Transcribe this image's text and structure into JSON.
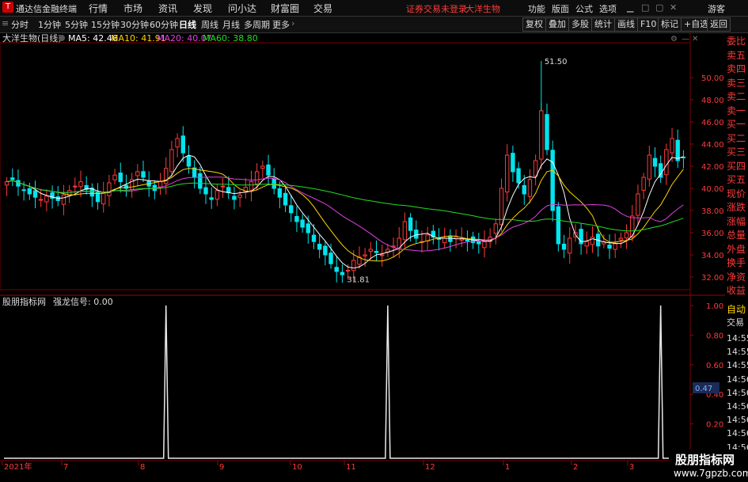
{
  "titlebar": {
    "app_name": "通达信金融终端",
    "menus": [
      "行情",
      "市场",
      "资讯",
      "发现",
      "问小达",
      "财富圈",
      "交易"
    ],
    "login_status": "证券交易未登录",
    "stock_name": "大洋生物",
    "right_menus": [
      "功能",
      "版面",
      "公式",
      "选项"
    ],
    "guest": "游客"
  },
  "toolbar": {
    "periods": [
      "分时",
      "1分钟",
      "5分钟",
      "15分钟",
      "30分钟",
      "60分钟",
      "日线",
      "周线",
      "月线",
      "多周期",
      "更多"
    ],
    "active_period": "日线",
    "right_buttons": [
      "复权",
      "叠加",
      "多股",
      "统计",
      "画线",
      "F10",
      "标记",
      "+自选",
      "返回"
    ]
  },
  "main_chart": {
    "title": "大洋生物(日线)",
    "ma": [
      {
        "label": "MA5: 42.46",
        "color": "#ffffff"
      },
      {
        "label": "MA10: 41.91",
        "color": "#ffd400"
      },
      {
        "label": "MA20: 40.07",
        "color": "#e040e0"
      },
      {
        "label": "MA60: 38.80",
        "color": "#22dd22"
      }
    ],
    "y_ticks": [
      "50.00",
      "48.00",
      "46.00",
      "44.00",
      "42.00",
      "40.00",
      "38.00",
      "36.00",
      "34.00",
      "32.00"
    ],
    "high_label": "51.50",
    "low_label": "31.81"
  },
  "indicator": {
    "title": "股朋指标网",
    "signal_label": "强龙信号: 0.00",
    "y_ticks": [
      "1.00",
      "0.80",
      "0.60",
      "0.40",
      "0.20"
    ],
    "cursor_value": "0.47"
  },
  "x_axis": {
    "labels": [
      "2021年",
      "7",
      "8",
      "9",
      "10",
      "11",
      "12",
      "1",
      "2",
      "3"
    ]
  },
  "sidebar": {
    "items": [
      "委比",
      "卖五",
      "卖四",
      "卖三",
      "卖二",
      "卖一",
      "买一",
      "买二",
      "买三",
      "买四",
      "买五",
      "现价",
      "涨跌",
      "涨幅",
      "总量",
      "外盘",
      "换手",
      "净资",
      "收益"
    ],
    "auto_trade": [
      "自动",
      "交易"
    ],
    "times": [
      "14:55",
      "14:55",
      "14:55",
      "14:56",
      "14:56",
      "14:56",
      "14:56",
      "14:56",
      "14:56",
      "14:56"
    ]
  },
  "watermark": {
    "line1": "股朋指标网",
    "line2": "www.7gpzb.com"
  },
  "chart_data": {
    "type": "candlestick",
    "title": "大洋生物(日线)",
    "ylim": [
      31,
      53
    ],
    "close": [
      40.6,
      40.8,
      40.2,
      39.8,
      39.5,
      39.2,
      39.0,
      39.3,
      39.1,
      38.9,
      39.4,
      39.8,
      40.2,
      40.6,
      39.9,
      39.3,
      38.8,
      39.6,
      40.5,
      41.2,
      40.6,
      40.0,
      40.8,
      41.5,
      41.0,
      40.2,
      39.8,
      40.6,
      41.8,
      43.5,
      44.5,
      43.2,
      42.0,
      41.0,
      40.0,
      39.5,
      39.0,
      39.8,
      40.2,
      39.6,
      39.0,
      39.4,
      40.1,
      40.6,
      41.5,
      42.0,
      41.2,
      40.0,
      39.2,
      38.5,
      37.8,
      37.0,
      36.5,
      36.0,
      35.2,
      34.5,
      34.0,
      33.2,
      32.5,
      32.2,
      32.6,
      33.5,
      33.8,
      34.0,
      34.5,
      34.2,
      34.0,
      34.5,
      34.8,
      35.5,
      37.0,
      36.2,
      35.5,
      35.2,
      35.8,
      35.6,
      35.4,
      35.5,
      35.2,
      35.6,
      35.5,
      35.3,
      35.1,
      35.0,
      35.2,
      35.6,
      36.8,
      40.0,
      43.0,
      41.5,
      40.5,
      39.5,
      40.8,
      42.5,
      47.0,
      43.5,
      38.0,
      35.0,
      34.5,
      35.5,
      36.0,
      35.0,
      35.2,
      35.6,
      34.8,
      35.2,
      34.6,
      35.0,
      35.5,
      36.0,
      37.5,
      39.5,
      41.0,
      43.0,
      42.0,
      41.0,
      43.5,
      44.5,
      42.5,
      42.8
    ],
    "ma5": [
      42.46
    ],
    "ma10": [
      41.91
    ],
    "ma20": [
      40.07
    ],
    "ma60": [
      38.8
    ],
    "high_point": 51.5,
    "low_point": 31.81,
    "signal": {
      "ylim": [
        0,
        1.0
      ],
      "spikes_at_index": [
        28,
        67,
        115
      ],
      "spike_value": 1.0
    }
  }
}
